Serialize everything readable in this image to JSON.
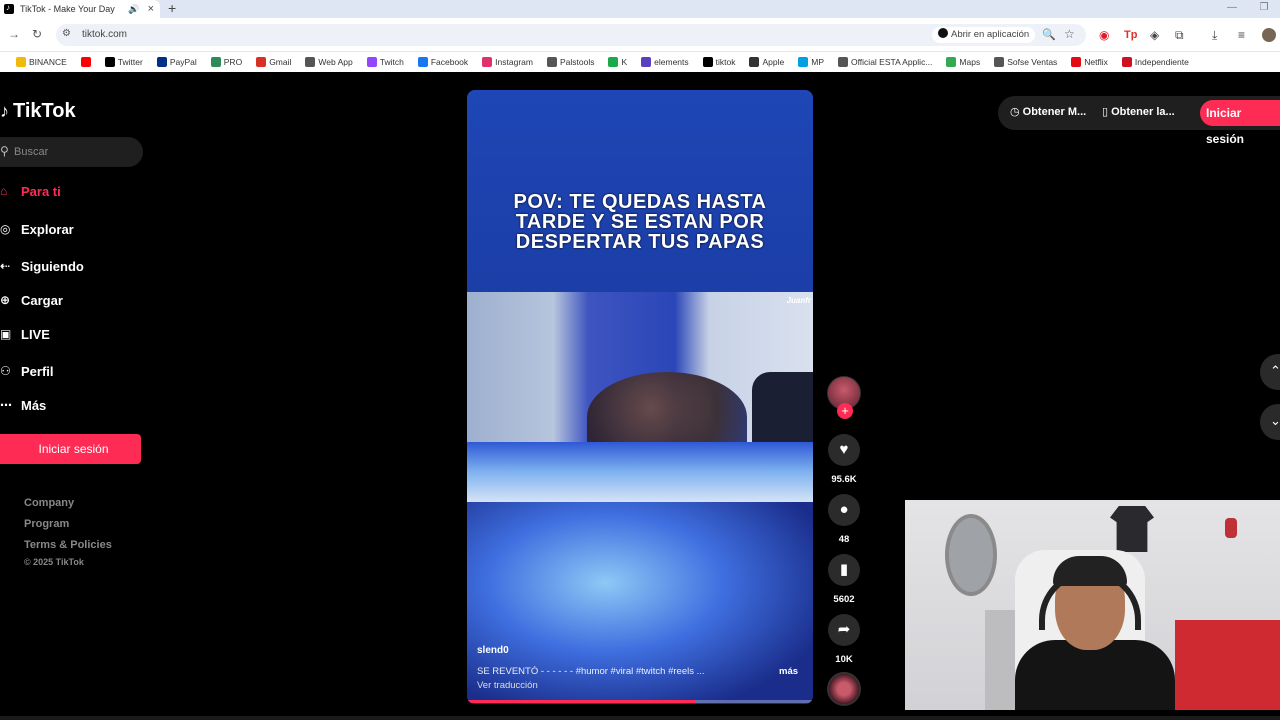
{
  "browser": {
    "tab_title": "TikTok - Make Your Day",
    "url": "tiktok.com",
    "open_in_app": "Abrir en aplicación",
    "bookmarks": [
      {
        "label": "BINANCE",
        "icon": "binance-icon",
        "color": "#f0b90b"
      },
      {
        "label": "",
        "icon": "youtube-icon",
        "color": "#ff0000"
      },
      {
        "label": "Twitter",
        "icon": "x-icon",
        "color": "#000000"
      },
      {
        "label": "PayPal",
        "icon": "paypal-icon",
        "color": "#003087"
      },
      {
        "label": "PRO",
        "icon": "pro-icon",
        "color": "#2e8b57"
      },
      {
        "label": "Gmail",
        "icon": "gmail-icon",
        "color": "#d93025"
      },
      {
        "label": "Web App",
        "icon": "globe-icon",
        "color": "#555555"
      },
      {
        "label": "Twitch",
        "icon": "twitch-icon",
        "color": "#9146ff"
      },
      {
        "label": "Facebook",
        "icon": "facebook-icon",
        "color": "#1877f2"
      },
      {
        "label": "Instagram",
        "icon": "instagram-icon",
        "color": "#e1306c"
      },
      {
        "label": "Palstools",
        "icon": "globe-icon",
        "color": "#555555"
      },
      {
        "label": "K",
        "icon": "k-icon",
        "color": "#1ba94c"
      },
      {
        "label": "elements",
        "icon": "elements-icon",
        "color": "#5a3fc0"
      },
      {
        "label": "tiktok",
        "icon": "tiktok-icon",
        "color": "#000000"
      },
      {
        "label": "Apple",
        "icon": "apple-icon",
        "color": "#333333"
      },
      {
        "label": "MP",
        "icon": "mp-icon",
        "color": "#00a0e3"
      },
      {
        "label": "Official ESTA Applic...",
        "icon": "esta-icon",
        "color": "#555555"
      },
      {
        "label": "Maps",
        "icon": "maps-icon",
        "color": "#34a853"
      },
      {
        "label": "Sofse Ventas",
        "icon": "globe-icon",
        "color": "#555555"
      },
      {
        "label": "Netflix",
        "icon": "netflix-icon",
        "color": "#e50914"
      },
      {
        "label": "Independiente",
        "icon": "independiente-icon",
        "color": "#d01020"
      }
    ]
  },
  "sidebar": {
    "logo": "TikTok",
    "search_placeholder": "Buscar",
    "nav": [
      {
        "label": "Para ti",
        "icon": "home-icon",
        "active": true
      },
      {
        "label": "Explorar",
        "icon": "compass-icon",
        "active": false
      },
      {
        "label": "Siguiendo",
        "icon": "following-icon",
        "active": false
      },
      {
        "label": "Cargar",
        "icon": "upload-icon",
        "active": false
      },
      {
        "label": "LIVE",
        "icon": "live-icon",
        "active": false
      },
      {
        "label": "Perfil",
        "icon": "profile-icon",
        "active": false
      },
      {
        "label": "Más",
        "icon": "more-icon",
        "active": false
      }
    ],
    "login_button": "Iniciar sesión",
    "footer": [
      "Company",
      "Program",
      "Terms & Policies"
    ],
    "copyright": "© 2025 TikTok"
  },
  "video": {
    "caption": "POV: TE QUEDAS HASTA TARDE Y SE ESTAN POR DESPERTAR TUS PAPAS",
    "watermark": "Juanfr",
    "author": "slend0",
    "description": "SE REVENTÓ - - - - - - #humor #viral #twitch #reels ...",
    "more": "más",
    "translate": "Ver traducción",
    "progress": 0.66
  },
  "actions": {
    "likes": "95.6K",
    "comments": "48",
    "saves": "5602",
    "shares": "10K"
  },
  "topbar": {
    "get_coins": "Obtener M...",
    "get_app": "Obtener la...",
    "login": "Iniciar sesión"
  },
  "colors": {
    "brand": "#fe2c55",
    "background": "#000000"
  }
}
